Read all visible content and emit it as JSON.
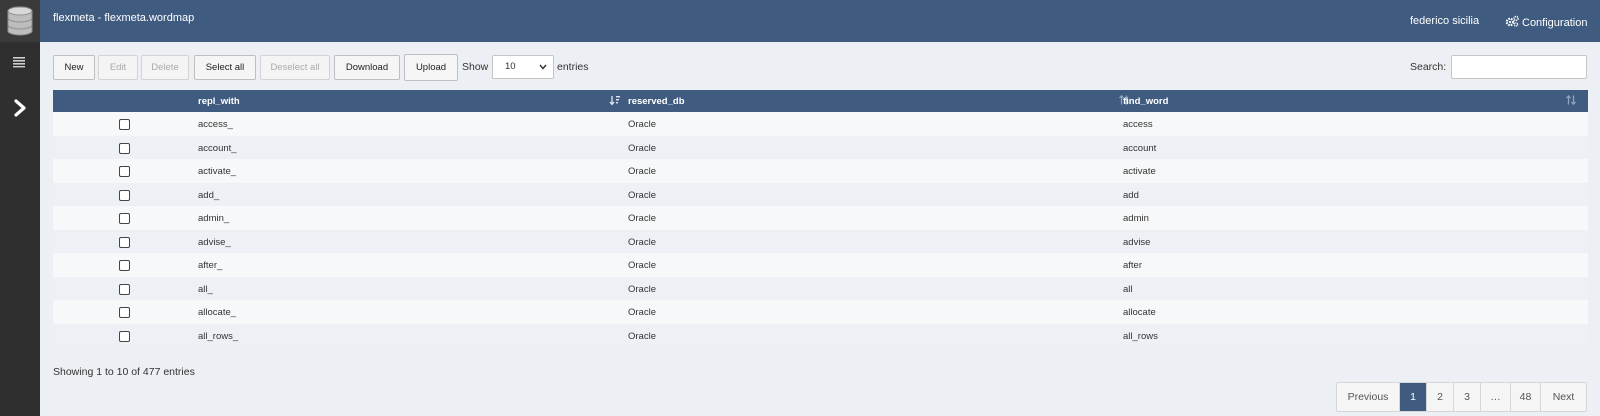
{
  "header": {
    "title": "flexmeta - flexmeta.wordmap",
    "user": "federico sicilia",
    "config_label": "Configuration"
  },
  "toolbar": {
    "new_label": "New",
    "edit_label": "Edit",
    "delete_label": "Delete",
    "select_all_label": "Select all",
    "deselect_all_label": "Deselect all",
    "download_label": "Download",
    "upload_label": "Upload",
    "show_label": "Show",
    "entries_value": "10",
    "entries_label": "entries",
    "search_label": "Search:",
    "search_value": ""
  },
  "table": {
    "columns": [
      "repl_with",
      "reserved_db",
      "find_word"
    ],
    "rows": [
      {
        "repl_with": "access_",
        "reserved_db": "Oracle",
        "find_word": "access"
      },
      {
        "repl_with": "account_",
        "reserved_db": "Oracle",
        "find_word": "account"
      },
      {
        "repl_with": "activate_",
        "reserved_db": "Oracle",
        "find_word": "activate"
      },
      {
        "repl_with": "add_",
        "reserved_db": "Oracle",
        "find_word": "add"
      },
      {
        "repl_with": "admin_",
        "reserved_db": "Oracle",
        "find_word": "admin"
      },
      {
        "repl_with": "advise_",
        "reserved_db": "Oracle",
        "find_word": "advise"
      },
      {
        "repl_with": "after_",
        "reserved_db": "Oracle",
        "find_word": "after"
      },
      {
        "repl_with": "all_",
        "reserved_db": "Oracle",
        "find_word": "all"
      },
      {
        "repl_with": "allocate_",
        "reserved_db": "Oracle",
        "find_word": "allocate"
      },
      {
        "repl_with": "all_rows_",
        "reserved_db": "Oracle",
        "find_word": "all_rows"
      }
    ]
  },
  "footer": {
    "info": "Showing 1 to 10 of 477 entries"
  },
  "pagination": {
    "previous": "Previous",
    "pages": [
      "1",
      "2",
      "3",
      "…",
      "48"
    ],
    "active_page": "1",
    "next": "Next"
  },
  "colors": {
    "header_bg": "#3f5b80",
    "sidebar_bg": "#2f2f2f",
    "page_bg": "#eceff3"
  },
  "icons": {
    "logo": "database-icon",
    "menu": "list-icon",
    "expand": "chevron-right-icon",
    "config": "gears-icon",
    "sort": "sort-icon"
  }
}
